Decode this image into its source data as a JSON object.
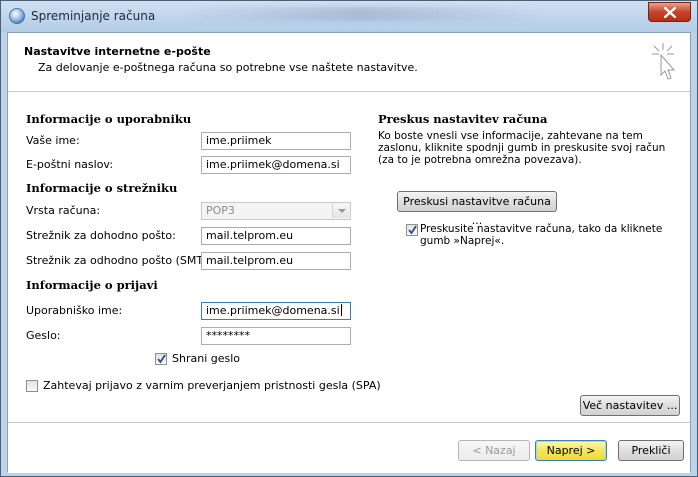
{
  "window": {
    "title": "Spreminjanje računa"
  },
  "header": {
    "title": "Nastavitve internetne e-pošte",
    "subtitle": "Za delovanje e-poštnega računa so potrebne vse naštete nastavitve."
  },
  "user_info": {
    "section_title": "Informacije o uporabniku",
    "name_label": "Vaše ime:",
    "name_value": "ime.priimek",
    "email_label": "E-poštni naslov:",
    "email_value": "ime.priimek@domena.si"
  },
  "server_info": {
    "section_title": "Informacije o strežniku",
    "account_type_label": "Vrsta računa:",
    "account_type_value": "POP3",
    "incoming_label": "Strežnik za dohodno pošto:",
    "incoming_value": "mail.telprom.eu",
    "outgoing_label": "Strežnik za odhodno pošto (SMTP):",
    "outgoing_value": "mail.telprom.eu"
  },
  "login_info": {
    "section_title": "Informacije o prijavi",
    "username_label": "Uporabniško ime:",
    "username_value": "ime.priimek@domena.si",
    "password_label": "Geslo:",
    "password_value": "********",
    "remember_label": "Shrani geslo",
    "remember_checked": true,
    "spa_label": "Zahtevaj prijavo z varnim preverjanjem pristnosti gesla (SPA)",
    "spa_checked": false
  },
  "test_settings": {
    "section_title": "Preskus nastavitev računa",
    "description": "Ko boste vnesli vse informacije, zahtevane na tem zaslonu, kliknite spodnji gumb in preskusite svoj račun (za to je potrebna omrežna povezava).",
    "test_button": "Preskusi nastavitve računa ...",
    "auto_test_label": "Preskusite nastavitve računa, tako da kliknete gumb »Naprej«.",
    "auto_test_checked": true,
    "more_settings_button": "Več nastavitev ..."
  },
  "footer": {
    "back_button": "< Nazaj",
    "next_button": "Naprej >",
    "cancel_button": "Prekliči"
  },
  "colors": {
    "primary_button": "#f3e55a",
    "focus_border": "#3c7fb1",
    "title_bar": "#bcd3ea",
    "close_button": "#c7442a"
  }
}
